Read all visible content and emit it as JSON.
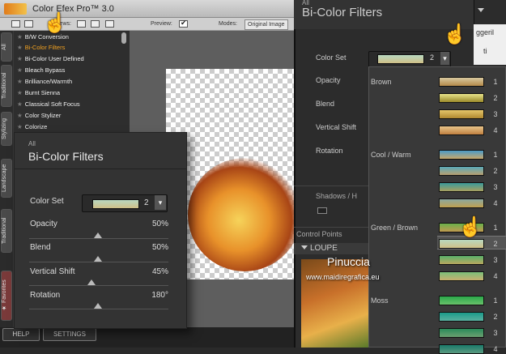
{
  "app": {
    "title": "Color Efex Pro™ 3.0",
    "toolbar": {
      "views_label": "iews:",
      "preview_label": "Preview:",
      "modes_label": "Modes:",
      "mode_value": "Original Image"
    },
    "side_tabs": [
      "All",
      "Traditional",
      "Stylizing",
      "Landscape",
      "Traditional",
      "★ Favorites"
    ],
    "filters": [
      "B/W Conversion",
      "Bi-Color Filters",
      "Bi-Color User Defined",
      "Bleach Bypass",
      "Brilliance/Warmth",
      "Burnt Sienna",
      "Classical Soft Focus",
      "Color Stylizer",
      "Colorize"
    ],
    "selected_filter_index": 1,
    "bottom_buttons": {
      "help": "HELP",
      "settings": "SETTINGS"
    }
  },
  "panel": {
    "category": "All",
    "title": "Bi-Color Filters",
    "color_set": {
      "label": "Color Set",
      "value": "2"
    },
    "sliders": [
      {
        "label": "Opacity",
        "value": "50%",
        "level": 0.5
      },
      {
        "label": "Blend",
        "value": "50%",
        "level": 0.5
      },
      {
        "label": "Vertical Shift",
        "value": "45%",
        "level": 0.45
      },
      {
        "label": "Rotation",
        "value": "180°",
        "level": 0.5
      }
    ]
  },
  "right_panel": {
    "category": "All",
    "title": "Bi-Color Filters",
    "color_set_label": "Color Set",
    "color_set_value": "2",
    "params": [
      "Opacity",
      "Blend",
      "Vertical Shift",
      "Rotation"
    ],
    "section_shadows": "Shadows / H",
    "section_control_points": "Control Points",
    "loupe_label": "LOUPE",
    "side_text": {
      "line1": "ggeril",
      "line2": "ti"
    }
  },
  "dropdown": {
    "groups": [
      {
        "name": "Brown",
        "items": [
          {
            "n": "1",
            "c1": "#d8c9a0",
            "c2": "#b58a4a"
          },
          {
            "n": "2",
            "c1": "#e8e38a",
            "c2": "#9a8a2a"
          },
          {
            "n": "3",
            "c1": "#e6c66a",
            "c2": "#b08830"
          },
          {
            "n": "4",
            "c1": "#e8c48a",
            "c2": "#c08040"
          }
        ]
      },
      {
        "name": "Cool / Warm",
        "items": [
          {
            "n": "1",
            "c1": "#4a9ac8",
            "c2": "#c8a86a"
          },
          {
            "n": "2",
            "c1": "#5aaab8",
            "c2": "#b8a070"
          },
          {
            "n": "3",
            "c1": "#3a9a9a",
            "c2": "#a8a060"
          },
          {
            "n": "4",
            "c1": "#8aa8a0",
            "c2": "#c0a050"
          }
        ]
      },
      {
        "name": "Green / Brown",
        "items": [
          {
            "n": "1",
            "c1": "#6ab04a",
            "c2": "#c09a50"
          },
          {
            "n": "2",
            "c1": "#b8d8c0",
            "c2": "#d0c088"
          },
          {
            "n": "3",
            "c1": "#5ab06a",
            "c2": "#b8a860"
          },
          {
            "n": "4",
            "c1": "#7ac07a",
            "c2": "#c8b070"
          }
        ]
      },
      {
        "name": "Moss",
        "items": [
          {
            "n": "1",
            "c1": "#2aa84a",
            "c2": "#6ac06a"
          },
          {
            "n": "2",
            "c1": "#1a9a8a",
            "c2": "#5ab0a0"
          },
          {
            "n": "3",
            "c1": "#2a8a5a",
            "c2": "#6aa070"
          },
          {
            "n": "4",
            "c1": "#1a7a6a",
            "c2": "#5a9a80"
          }
        ]
      }
    ],
    "selected": {
      "group": 2,
      "item": 1
    }
  },
  "watermark": {
    "name": "Pinuccia",
    "url": "www.maidiregrafica.eu"
  },
  "colors": {
    "accent_selected": "#f0a020",
    "panel_bg": "#333333",
    "pointer": "#f5c400"
  },
  "icons": [
    "hand-pointer-icon",
    "star-icon",
    "dropdown-arrow-icon",
    "checkbox-icon"
  ]
}
